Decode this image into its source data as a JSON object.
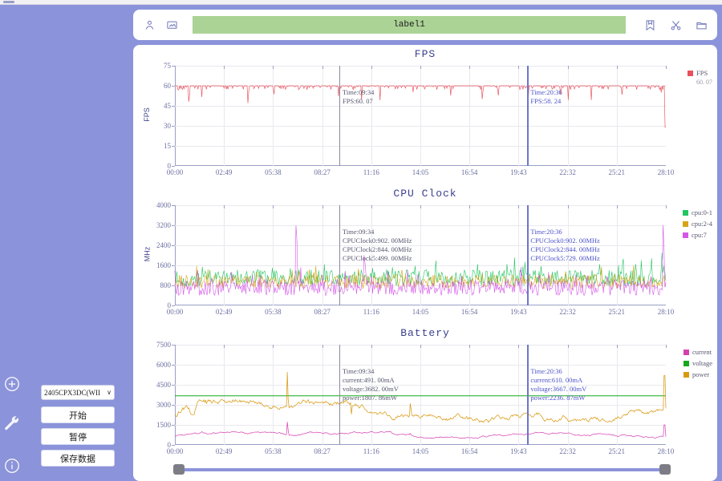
{
  "window": {
    "chrome_visible": true
  },
  "sidebar": {
    "rail_icons": [
      {
        "name": "add-icon",
        "glyph": "plus-circle"
      },
      {
        "name": "wrench-icon",
        "glyph": "wrench"
      },
      {
        "name": "info-icon",
        "glyph": "info-circle"
      }
    ],
    "device_select": {
      "value": "2405CPX3DC(WII",
      "caret": "∨"
    },
    "buttons": [
      {
        "name": "start-button",
        "label": "开始"
      },
      {
        "name": "pause-button",
        "label": "暂停"
      },
      {
        "name": "save-data-button",
        "label": "保存数据"
      }
    ]
  },
  "toolbar": {
    "left_icons": [
      {
        "name": "user-icon",
        "glyph": "person"
      },
      {
        "name": "screen-icon",
        "glyph": "monitor"
      }
    ],
    "label_field": {
      "value": "label1",
      "placeholder": "label1",
      "color": "#acd396"
    },
    "right_icons": [
      {
        "name": "bookmark-icon",
        "glyph": "bookmark"
      },
      {
        "name": "scissors-icon",
        "glyph": "scissors"
      },
      {
        "name": "folder-icon",
        "glyph": "folder"
      }
    ]
  },
  "range_slider": {
    "left_value": "00:00",
    "right_value": "28:10"
  },
  "colors": {
    "accent": "#8b93da",
    "fps": "#e8505b",
    "cpu01": "#22c55e",
    "cpu24": "#d6a417",
    "cpu7": "#d457e8",
    "current": "#d63fb0",
    "voltage": "#16a81f",
    "power": "#d99a12",
    "cursor_a": "#8a8a9e",
    "cursor_b": "#6e74cc"
  },
  "chart_data": [
    {
      "type": "line",
      "name": "fps-chart",
      "title": "FPS",
      "ylabel": "FPS",
      "xlabel": "",
      "ylim": [
        0,
        75
      ],
      "yticks": [
        0,
        15,
        30,
        45,
        60,
        75
      ],
      "xticks": [
        "00:00",
        "02:49",
        "05:38",
        "08:27",
        "11:16",
        "14:05",
        "16:54",
        "19:43",
        "22:32",
        "25:21",
        "28:10"
      ],
      "grid": true,
      "legend_position": "right",
      "series": [
        {
          "name": "FPS",
          "color": "#e8505b",
          "current_value": "60. 07",
          "baseline": 60
        }
      ],
      "cursors": [
        {
          "id": "cursor-a",
          "x_frac": 0.335,
          "color": "#8a8a9e",
          "readout": [
            "Time:09:34",
            "FPS:60. 07"
          ]
        },
        {
          "id": "cursor-b",
          "x_frac": 0.718,
          "color": "#6e74cc",
          "readout": [
            "Time:20:36",
            "FPS:58. 24"
          ]
        }
      ]
    },
    {
      "type": "line",
      "name": "cpu-clock-chart",
      "title": "CPU Clock",
      "ylabel": "MHz",
      "xlabel": "",
      "ylim": [
        0,
        4000
      ],
      "yticks": [
        0,
        800,
        1600,
        2400,
        3200,
        4000
      ],
      "xticks": [
        "00:00",
        "02:49",
        "05:38",
        "08:27",
        "11:16",
        "14:05",
        "16:54",
        "19:43",
        "22:32",
        "25:21",
        "28:10"
      ],
      "grid": true,
      "legend_position": "right",
      "series": [
        {
          "name": "cpu:0-1",
          "color": "#22c55e",
          "baseline": 1100
        },
        {
          "name": "cpu:2-4",
          "color": "#d6a417",
          "baseline": 950
        },
        {
          "name": "cpu:7",
          "color": "#d457e8",
          "baseline": 700
        }
      ],
      "cursors": [
        {
          "id": "cursor-a",
          "x_frac": 0.335,
          "color": "#8a8a9e",
          "readout": [
            "Time:09:34",
            "CPUClock0:902. 00MHz",
            "CPUClock2:844. 00MHz",
            "CPUClock5:499. 00MHz"
          ]
        },
        {
          "id": "cursor-b",
          "x_frac": 0.718,
          "color": "#6e74cc",
          "readout": [
            "Time:20:36",
            "CPUClock0:902. 00MHz",
            "CPUClock2:844. 00MHz",
            "CPUClock5:729. 00MHz"
          ]
        }
      ]
    },
    {
      "type": "line",
      "name": "battery-chart",
      "title": "Battery",
      "ylabel": "",
      "xlabel": "",
      "ylim": [
        0,
        7500
      ],
      "yticks": [
        0,
        1500,
        3000,
        4500,
        6000,
        7500
      ],
      "xticks": [
        "00:00",
        "02:49",
        "05:38",
        "08:27",
        "11:16",
        "14:05",
        "16:54",
        "19:43",
        "22:32",
        "25:21",
        "28:10"
      ],
      "grid": true,
      "legend_position": "right",
      "series": [
        {
          "name": "current",
          "color": "#d63fb0",
          "baseline": 560
        },
        {
          "name": "voltage",
          "color": "#16a81f",
          "baseline": 3675
        },
        {
          "name": "power",
          "color": "#d99a12",
          "baseline": 1820
        }
      ],
      "cursors": [
        {
          "id": "cursor-a",
          "x_frac": 0.335,
          "color": "#8a8a9e",
          "readout": [
            "Time:09:34",
            "current:491. 00mA",
            "voltage:3682. 00mV",
            "power:1807. 86mW"
          ]
        },
        {
          "id": "cursor-b",
          "x_frac": 0.718,
          "color": "#6e74cc",
          "readout": [
            "Time:20:36",
            "current:610. 00mA",
            "voltage:3667. 00mV",
            "power:2236. 87mW"
          ]
        }
      ]
    }
  ]
}
